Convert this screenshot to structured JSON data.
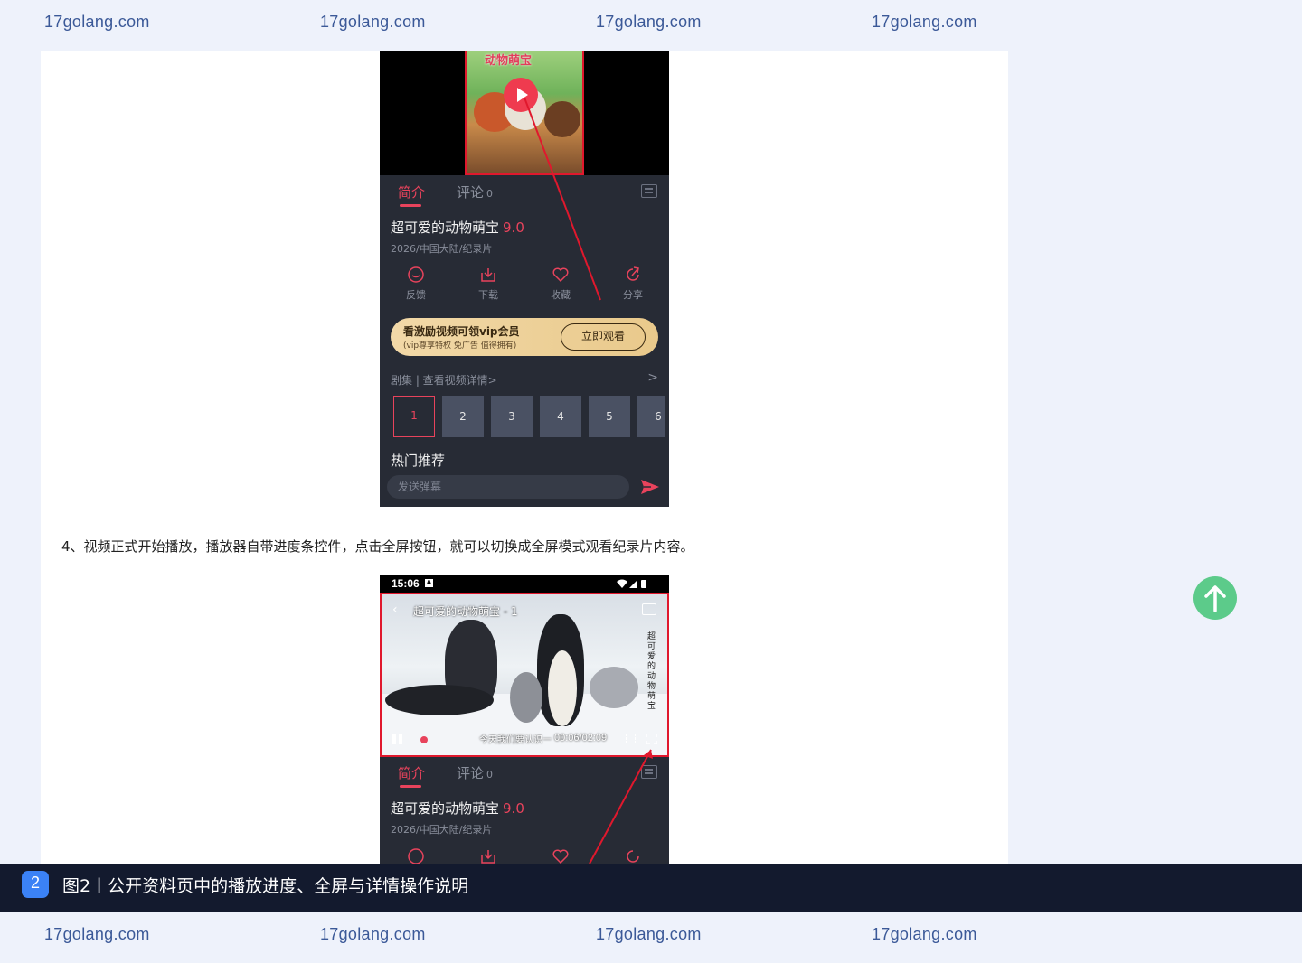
{
  "watermark": {
    "top": [
      "17golang.com",
      "17golang.com",
      "17golang.com",
      "17golang.com"
    ],
    "bottom": [
      "17golang.com",
      "17golang.com",
      "17golang.com",
      "17golang.com"
    ]
  },
  "phone1": {
    "poster_title": "动物萌宝",
    "tabs": {
      "intro": "简介",
      "comments": "评论",
      "comments_count": "0"
    },
    "title": "超可爱的动物萌宝",
    "score": "9.0",
    "meta": "2026/中国大陆/纪录片",
    "actions": [
      {
        "label": "反馈",
        "icon": "feedback-icon"
      },
      {
        "label": "下载",
        "icon": "download-icon"
      },
      {
        "label": "收藏",
        "icon": "heart-icon"
      },
      {
        "label": "分享",
        "icon": "share-icon"
      }
    ],
    "vip": {
      "line1": "看激励视频可领vip会员",
      "line2": "(vip尊享特权 免广告 值得拥有)",
      "button": "立即观看"
    },
    "episodes_header": "剧集 | 查看视频详情>",
    "episodes_arrow": ">",
    "episodes": [
      "1",
      "2",
      "3",
      "4",
      "5",
      "6"
    ],
    "current_episode": "1",
    "hot_title": "热门推荐",
    "danmaku_placeholder": "发送弹幕",
    "accent_color": "#e8435c"
  },
  "instruction": "4、视频正式开始播放，播放器自带进度条控件，点击全屏按钮，就可以切换成全屏模式观看纪录片内容。",
  "phone2": {
    "status_time": "15:06",
    "status_badge": "A",
    "video_title": "超可爱的动物萌宝 - 1",
    "vertical_text": "超可爱的动物萌宝",
    "subtitle": "今天我们要认识一",
    "time": "00:06/02:09",
    "progress_fraction": 0.05,
    "tabs": {
      "intro": "简介",
      "comments": "评论",
      "comments_count": "0"
    },
    "title": "超可爱的动物萌宝",
    "score": "9.0",
    "meta": "2026/中国大陆/纪录片"
  },
  "caption": {
    "badge": "2",
    "text": "图2丨公开资料页中的播放进度、全屏与详情操作说明"
  },
  "colors": {
    "annotation_red": "#e0182d",
    "back_to_top": "#5ccb8a",
    "caption_bg": "#131a2e"
  }
}
